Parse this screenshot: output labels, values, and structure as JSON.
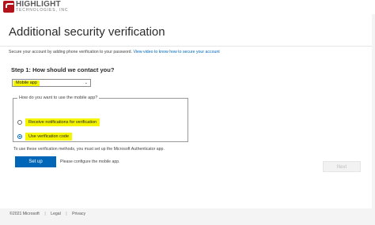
{
  "header": {
    "logo_name": "HIGHLIGHT",
    "logo_sub": "TECHNOLOGIES, INC"
  },
  "page": {
    "title": "Additional security verification",
    "description": "Secure your account by adding phone verification to your password.",
    "video_link": "View video to know how to secure your account"
  },
  "step1": {
    "heading": "Step 1: How should we contact you?",
    "selected_method": "Mobile app",
    "question": "How do you want to use the mobile app?",
    "options": [
      {
        "label": "Receive notifications for verification",
        "selected": false
      },
      {
        "label": "Use verification code",
        "selected": true
      }
    ],
    "hint": "To use these verification methods, you must set up the Microsoft Authenticator app.",
    "setup_label": "Set up",
    "setup_note": "Please configure the mobile app."
  },
  "actions": {
    "next_label": "Next"
  },
  "footer": {
    "copyright": "©2021 Microsoft",
    "legal": "Legal",
    "privacy": "Privacy"
  },
  "colors": {
    "accent": "#0067b8",
    "highlight": "#f5f500",
    "brand": "#b3141c"
  }
}
